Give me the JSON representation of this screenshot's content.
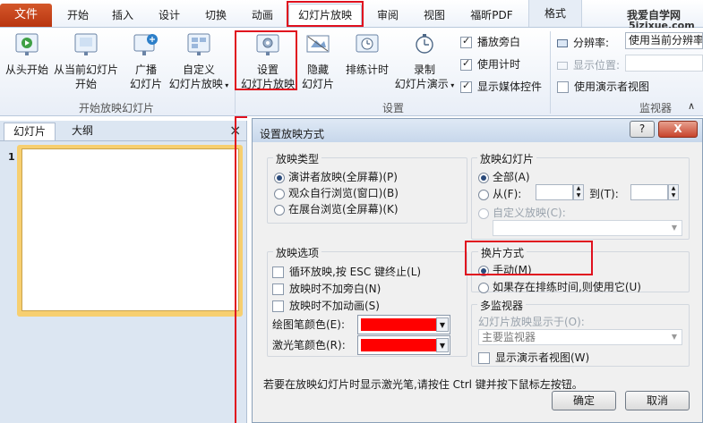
{
  "tabs": {
    "file": "文件",
    "home": "开始",
    "insert": "插入",
    "design": "设计",
    "transitions": "切换",
    "animations": "动画",
    "slideshow": "幻灯片放映",
    "review": "审阅",
    "view": "视图",
    "foxit": "福昕PDF",
    "format": "格式"
  },
  "watermark": {
    "line1": "我爱自学网",
    "line2": "5izixue.com"
  },
  "ribbon": {
    "from_start": "从头开始",
    "from_current_1": "从当前幻灯片",
    "from_current_2": "开始",
    "broadcast_1": "广播",
    "broadcast_2": "幻灯片",
    "custom_1": "自定义",
    "custom_2": "幻灯片放映",
    "group_start": "开始放映幻灯片",
    "setup_1": "设置",
    "setup_2": "幻灯片放映",
    "hide_1": "隐藏",
    "hide_2": "幻灯片",
    "rehearse": "排练计时",
    "record_1": "录制",
    "record_2": "幻灯片演示",
    "play_narration": "播放旁白",
    "use_timings": "使用计时",
    "show_media": "显示媒体控件",
    "group_setup": "设置",
    "resolution_label": "分辨率:",
    "resolution_value": "使用当前分辨率",
    "show_on": "显示位置:",
    "presenter_view": "使用演示者视图",
    "group_monitors": "监视器"
  },
  "pane": {
    "tab_slides": "幻灯片",
    "tab_outline": "大纲",
    "close": "×",
    "slide_number": "1"
  },
  "dialog": {
    "title": "设置放映方式",
    "help": "?",
    "close": "X",
    "show_type": "放映类型",
    "type_presenter": "演讲者放映(全屏幕)(P)",
    "type_browsed": "观众自行浏览(窗口)(B)",
    "type_kiosk": "在展台浏览(全屏幕)(K)",
    "show_slides": "放映幻灯片",
    "all": "全部(A)",
    "from": "从(F):",
    "to": "到(T):",
    "custom_show": "自定义放映(C):",
    "show_options": "放映选项",
    "loop": "循环放映,按 ESC 键终止(L)",
    "no_narration": "放映时不加旁白(N)",
    "no_animation": "放映时不加动画(S)",
    "pen_color": "绘图笔颜色(E):",
    "laser_color": "激光笔颜色(R):",
    "advance": "换片方式",
    "manual": "手动(M)",
    "use_timings": "如果存在排练时间,则使用它(U)",
    "multi_monitor": "多监视器",
    "display_on": "幻灯片放映显示于(O):",
    "monitor_value": "主要监视器",
    "show_presenter": "显示演示者视图(W)",
    "hint": "若要在放映幻灯片时显示激光笔,请按住 Ctrl 键并按下鼠标左按钮。",
    "ok": "确定",
    "cancel": "取消"
  },
  "colors": {
    "accent_red": "#e0101e",
    "pen": "#ff0000",
    "file_tab": "#c8441a"
  }
}
